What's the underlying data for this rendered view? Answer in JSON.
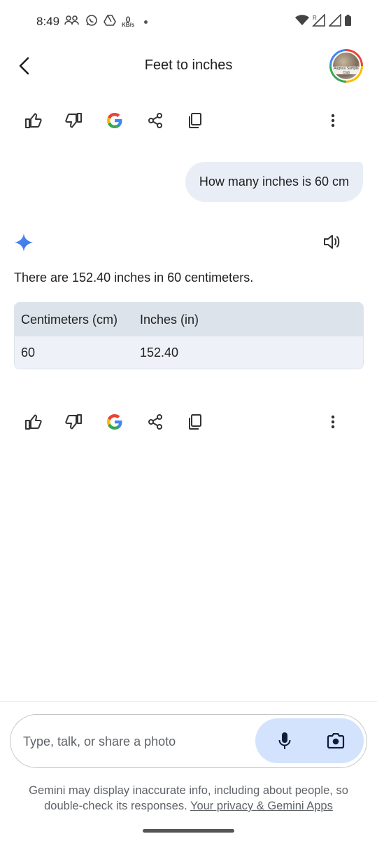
{
  "status_bar": {
    "time": "8:49",
    "kb_value": "0",
    "kb_unit": "KB/s",
    "roaming_mark": "R"
  },
  "header": {
    "title": "Feet to inches"
  },
  "avatar": {
    "badge_text": "Aagnuu Sample Club"
  },
  "conversation": {
    "user_message": "How many inches is 60 cm",
    "response_text": "There are 152.40 inches in 60 centimeters.",
    "table": {
      "headers": [
        "Centimeters (cm)",
        "Inches (in)"
      ],
      "rows": [
        [
          "60",
          "152.40"
        ]
      ]
    }
  },
  "input": {
    "placeholder": "Type, talk, or share a photo"
  },
  "disclaimer": {
    "text": "Gemini may display inaccurate info, including about people, so double-check its responses.",
    "link": "Your privacy & Gemini Apps"
  },
  "icons": {
    "action_bar": [
      "thumbs-up-icon",
      "thumbs-down-icon",
      "google-icon",
      "share-icon",
      "copy-icon",
      "more-vert-icon"
    ],
    "google_colors": [
      "#4285f4",
      "#ea4335",
      "#fbbc05",
      "#34a853"
    ],
    "accent": "#d3e3fd"
  }
}
